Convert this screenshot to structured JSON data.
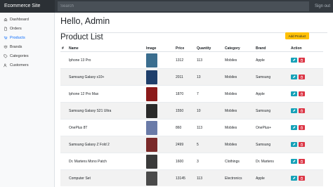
{
  "topbar": {
    "brand": "Ecommerce Site",
    "search_placeholder": "Search",
    "signout": "Sign out"
  },
  "sidebar": {
    "items": [
      {
        "label": "Dashboard",
        "icon": "home-icon"
      },
      {
        "label": "Orders",
        "icon": "file-icon"
      },
      {
        "label": "Products",
        "icon": "cart-icon"
      },
      {
        "label": "Brands",
        "icon": "layers-icon"
      },
      {
        "label": "Categories",
        "icon": "tag-icon"
      },
      {
        "label": "Customers",
        "icon": "users-icon"
      }
    ]
  },
  "main": {
    "greeting": "Hello, Admin",
    "title": "Product List",
    "add_label": "Add Product",
    "columns": [
      "#",
      "Name",
      "Image",
      "Price",
      "Quantity",
      "Category",
      "Brand",
      "Action"
    ],
    "rows": [
      {
        "name": "Iphone 13 Pro",
        "price": "1312",
        "qty": "113",
        "category": "Mobiles",
        "brand": "Apple",
        "color": "#3b6e8f"
      },
      {
        "name": "Samsung Galaxy s10+",
        "price": "2011",
        "qty": "13",
        "category": "Mobiles",
        "brand": "Samsung",
        "color": "#1f3f6b"
      },
      {
        "name": "Iphone 12 Pro Max",
        "price": "1870",
        "qty": "7",
        "category": "Mobiles",
        "brand": "Apple",
        "color": "#8b1a1a"
      },
      {
        "name": "Samsung Galaxy S21 Ultra",
        "price": "1550",
        "qty": "10",
        "category": "Mobiles",
        "brand": "Samsung",
        "color": "#2a2a2a"
      },
      {
        "name": "OnePlus 8T",
        "price": "860",
        "qty": "113",
        "category": "Mobiles",
        "brand": "OnePlus+",
        "color": "#6a7ba8"
      },
      {
        "name": "Samsung Galaxy Z Fold 2",
        "price": "2499",
        "qty": "5",
        "category": "Mobiles",
        "brand": "Samsung",
        "color": "#7a2a2a"
      },
      {
        "name": "Dr. Martens Mono Patch",
        "price": "1600",
        "qty": "3",
        "category": "Clothings",
        "brand": "Dr. Martens",
        "color": "#3a3a3a"
      },
      {
        "name": "Computer Set",
        "price": "13145",
        "qty": "113",
        "category": "Electronics",
        "brand": "Apple",
        "color": "#4a4a4a"
      }
    ]
  }
}
